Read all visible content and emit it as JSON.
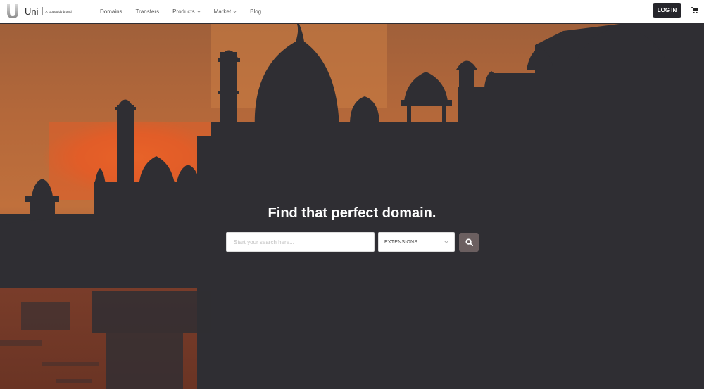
{
  "brand": {
    "name": "Uni",
    "tagline": "A GoDaddy brand"
  },
  "nav": {
    "items": [
      {
        "label": "Domains",
        "dropdown": false
      },
      {
        "label": "Transfers",
        "dropdown": false
      },
      {
        "label": "Products",
        "dropdown": true
      },
      {
        "label": "Market",
        "dropdown": true
      },
      {
        "label": "Blog",
        "dropdown": false
      }
    ],
    "login_label": "LOG IN"
  },
  "hero": {
    "headline": "Find that perfect domain.",
    "search_placeholder": "Start your search here...",
    "extensions_label": "EXTENSIONS"
  },
  "colors": {
    "sky_top": "#a0603a",
    "sky_mid": "#c8763c",
    "sun_glow": "#e05f2a",
    "silhouette": "#2f2e33",
    "login_bg": "#25252b",
    "search_button": "#6b5f60"
  },
  "icons": {
    "cart": "cart-icon",
    "search": "search-icon",
    "chevron": "chevron-down-icon"
  }
}
